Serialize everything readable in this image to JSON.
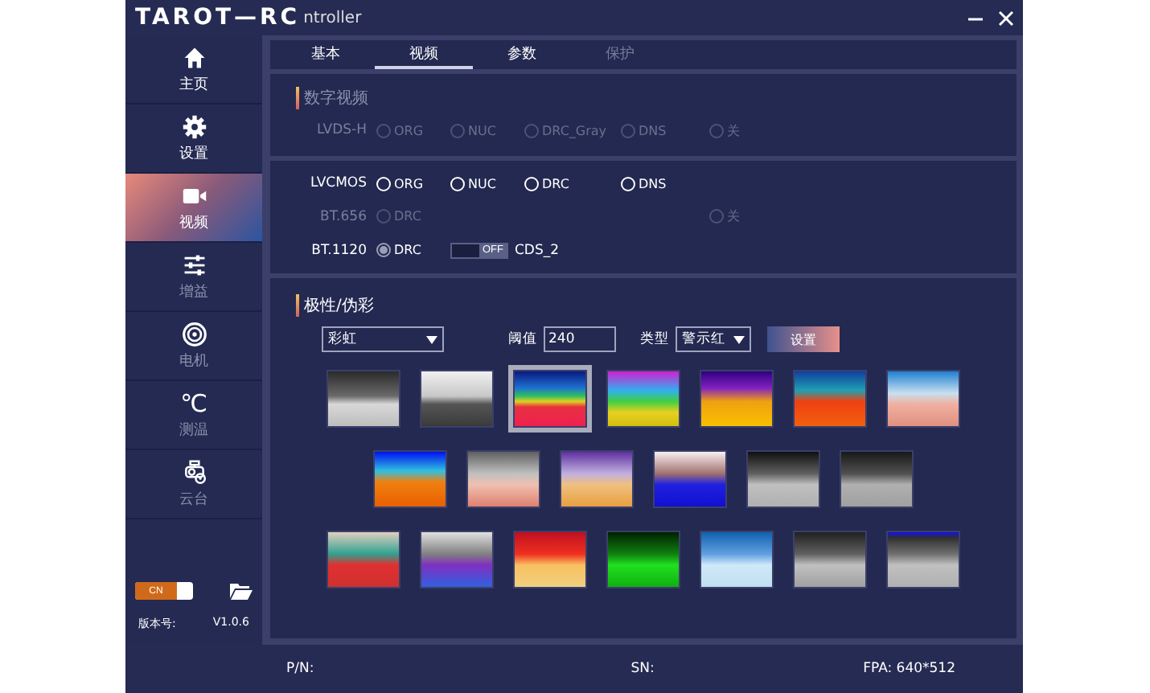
{
  "window": {
    "logo": "TAROT—RC",
    "title": "ntroller"
  },
  "sidebar": {
    "items": [
      {
        "kind": "home",
        "label": "主页",
        "selected": false,
        "disabled": false
      },
      {
        "kind": "gear",
        "label": "设置",
        "selected": false,
        "disabled": false
      },
      {
        "kind": "video",
        "label": "视频",
        "selected": true,
        "disabled": false
      },
      {
        "kind": "sliders",
        "label": "增益",
        "selected": false,
        "disabled": true
      },
      {
        "kind": "motor",
        "label": "电机",
        "selected": false,
        "disabled": true
      },
      {
        "kind": "celsius",
        "label": "测温",
        "selected": false,
        "disabled": true,
        "glyph": "℃"
      },
      {
        "kind": "gimbal",
        "label": "云台",
        "selected": false,
        "disabled": true
      }
    ],
    "language_switch": {
      "label": "CN",
      "on": true
    },
    "version_label": "版本号:",
    "version": "V1.0.6"
  },
  "tabs": [
    {
      "label": "基本",
      "selected": false,
      "disabled": false
    },
    {
      "label": "视频",
      "selected": true,
      "disabled": false
    },
    {
      "label": "参数",
      "selected": false,
      "disabled": false
    },
    {
      "label": "保护",
      "selected": false,
      "disabled": true
    }
  ],
  "digital_video": {
    "title": "数字视频",
    "rows": [
      {
        "label": "LVDS-H",
        "disabled": true,
        "options": [
          {
            "label": "ORG",
            "selected": false
          },
          {
            "label": "NUC",
            "selected": false
          },
          {
            "label": "DRC_Gray",
            "selected": false
          },
          {
            "label": "DNS",
            "selected": false
          }
        ],
        "off_option": {
          "label": "关",
          "selected": false
        }
      }
    ]
  },
  "output": {
    "rows": [
      {
        "label": "LVCMOS",
        "disabled": false,
        "options": [
          {
            "label": "ORG",
            "selected": false
          },
          {
            "label": "NUC",
            "selected": false
          },
          {
            "label": "DRC",
            "selected": false
          },
          {
            "label": "DNS",
            "selected": false
          }
        ]
      },
      {
        "label": "BT.656",
        "disabled": true,
        "options": [
          {
            "label": "DRC",
            "selected": false
          }
        ],
        "off_option": {
          "label": "关",
          "selected": false
        }
      },
      {
        "label": "BT.1120",
        "disabled": false,
        "options": [
          {
            "label": "DRC",
            "selected": true
          }
        ],
        "switch": {
          "state_label": "OFF",
          "on": false,
          "caption": "CDS_2"
        }
      }
    ]
  },
  "polarity": {
    "title": "极性/伪彩",
    "palette_select": "彩虹",
    "threshold_label": "阈值",
    "threshold": "240",
    "type_label": "类型",
    "type_select": "警示红",
    "apply_button": "设置",
    "palette_rows": [
      [
        {
          "selected": false
        },
        {
          "selected": false
        },
        {
          "selected": true
        },
        {
          "selected": false
        },
        {
          "selected": false
        },
        {
          "selected": false
        },
        {
          "selected": false
        }
      ],
      [
        {
          "selected": false
        },
        {
          "selected": false
        },
        {
          "selected": false
        },
        {
          "selected": false
        },
        {
          "selected": false
        },
        {
          "selected": false
        }
      ],
      [
        {
          "selected": false
        },
        {
          "selected": false
        },
        {
          "selected": false
        },
        {
          "selected": false
        },
        {
          "selected": false
        },
        {
          "selected": false
        },
        {
          "selected": false
        }
      ]
    ]
  },
  "status_bar": {
    "pn_label": "P/N:",
    "sn_label": "SN:",
    "fpa": "FPA:  640*512"
  }
}
